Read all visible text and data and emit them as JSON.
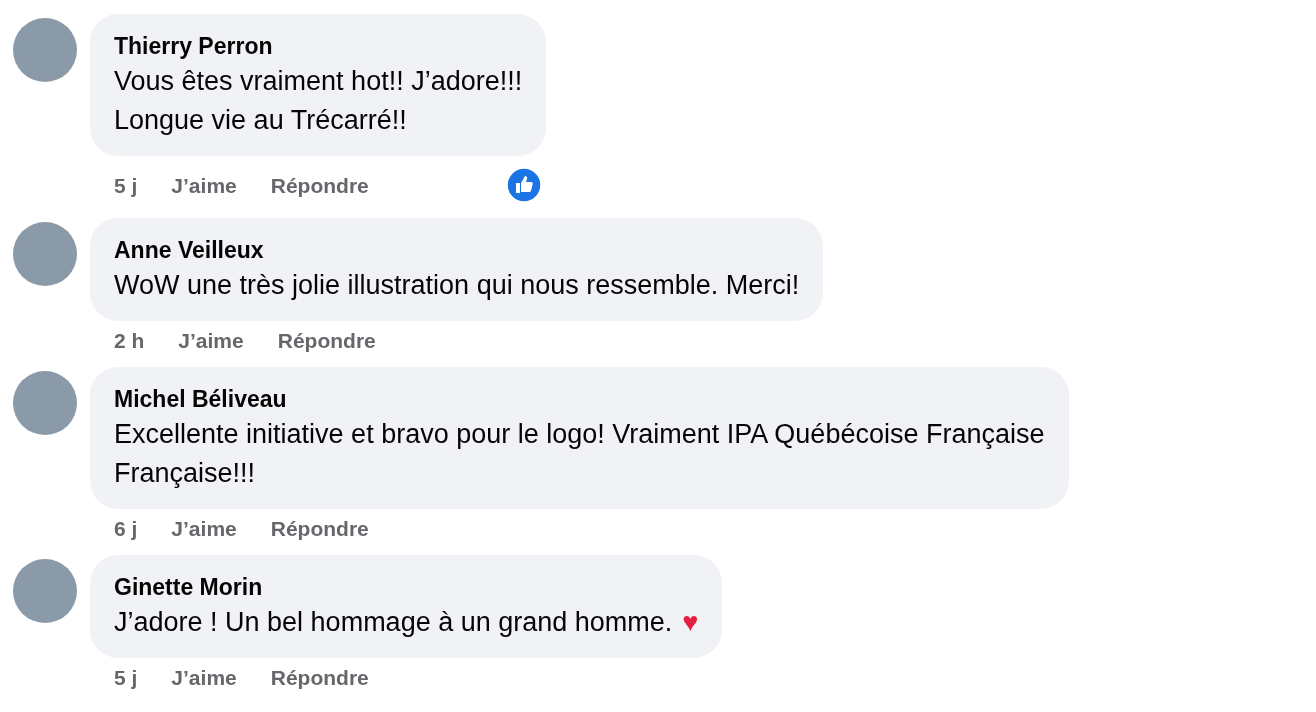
{
  "comments": [
    {
      "name": "Thierry Perron",
      "lines": [
        "Vous êtes vraiment hot!! J’adore!!!",
        "Longue vie au Trécarré!!"
      ],
      "time": "5 j",
      "like": "J’aime",
      "reply": "Répondre",
      "liked": true
    },
    {
      "name": "Anne Veilleux",
      "lines": [
        "WoW une très jolie illustration qui nous ressemble. Merci!"
      ],
      "time": "2 h",
      "like": "J’aime",
      "reply": "Répondre",
      "liked": false
    },
    {
      "name": "Michel Béliveau",
      "lines": [
        "Excellente initiative et bravo pour le logo! Vraiment IPA Québécoise Française",
        "Française!!!"
      ],
      "time": "6 j",
      "like": "J’aime",
      "reply": "Répondre",
      "liked": false
    },
    {
      "name": "Ginette Morin",
      "lines": [
        "J’adore ! Un bel hommage à un grand homme."
      ],
      "emoji": "♥",
      "time": "5 j",
      "like": "J’aime",
      "reply": "Répondre",
      "liked": false
    }
  ]
}
